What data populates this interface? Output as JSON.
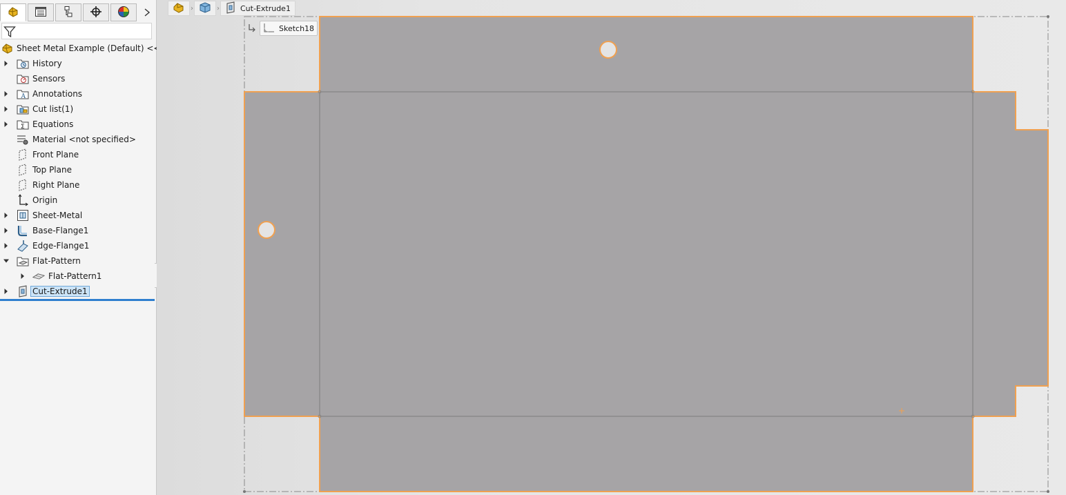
{
  "panel": {
    "tabs": [
      {
        "name": "feature-manager-icon"
      },
      {
        "name": "property-manager-icon"
      },
      {
        "name": "configuration-manager-icon"
      },
      {
        "name": "dimxpert-manager-icon"
      },
      {
        "name": "display-manager-icon"
      }
    ],
    "more_icon": "chevron-right-icon",
    "filter_icon": "filter-icon"
  },
  "tree": {
    "root_label": "Sheet Metal Example  (Default) <<Defa",
    "items": [
      {
        "label": "History",
        "icon": "history-folder-icon",
        "expander": "collapsed"
      },
      {
        "label": "Sensors",
        "icon": "sensors-icon",
        "expander": "none"
      },
      {
        "label": "Annotations",
        "icon": "annotations-icon",
        "expander": "collapsed"
      },
      {
        "label": "Cut list(1)",
        "icon": "cut-list-icon",
        "expander": "collapsed"
      },
      {
        "label": "Equations",
        "icon": "equations-icon",
        "expander": "collapsed"
      },
      {
        "label": "Material <not specified>",
        "icon": "material-icon",
        "expander": "none"
      },
      {
        "label": "Front Plane",
        "icon": "plane-icon",
        "expander": "none"
      },
      {
        "label": "Top Plane",
        "icon": "plane-icon",
        "expander": "none"
      },
      {
        "label": "Right Plane",
        "icon": "plane-icon",
        "expander": "none"
      },
      {
        "label": "Origin",
        "icon": "origin-icon",
        "expander": "none"
      },
      {
        "label": "Sheet-Metal",
        "icon": "sheet-metal-icon",
        "expander": "collapsed"
      },
      {
        "label": "Base-Flange1",
        "icon": "base-flange-icon",
        "expander": "collapsed"
      },
      {
        "label": "Edge-Flange1",
        "icon": "edge-flange-icon",
        "expander": "collapsed"
      },
      {
        "label": "Flat-Pattern",
        "icon": "flat-pattern-folder-icon",
        "expander": "expanded"
      },
      {
        "label": "Flat-Pattern1",
        "icon": "flat-pattern-icon",
        "expander": "collapsed"
      },
      {
        "label": "Cut-Extrude1",
        "icon": "cut-extrude-icon",
        "expander": "collapsed",
        "selected": true
      }
    ]
  },
  "breadcrumb": {
    "items": [
      {
        "icon": "part-icon"
      },
      {
        "icon": "solid-body-icon"
      },
      {
        "icon": "cut-extrude-icon",
        "label": "Cut-Extrude1"
      }
    ]
  },
  "sketch_tag": {
    "label": "Sketch18",
    "icon": "sketch-icon"
  },
  "colors": {
    "sheet_fill": "#a6a4a6",
    "edge_highlight": "#f0a050",
    "bend_line": "#7c7c7c",
    "bbox_line": "#8a8a8a",
    "selection_blue": "#2f7fcf"
  }
}
